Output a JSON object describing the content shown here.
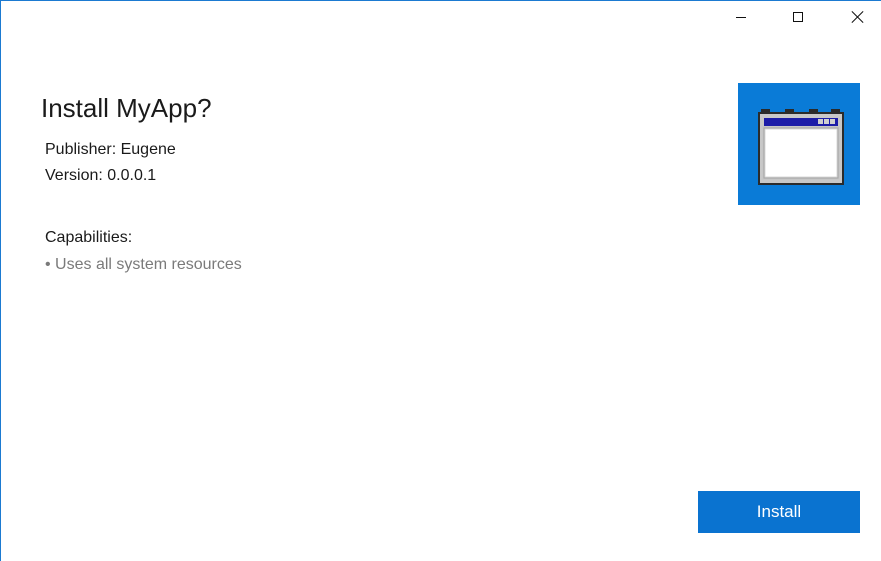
{
  "window": {
    "controls": {
      "minimize_icon": "minimize-icon",
      "maximize_icon": "maximize-icon",
      "close_icon": "close-icon"
    }
  },
  "header": {
    "title": "Install MyApp?"
  },
  "details": {
    "publisher": "Publisher: Eugene",
    "version": "Version: 0.0.0.1"
  },
  "capabilities": {
    "heading": "Capabilities:",
    "items": [
      "• Uses all system resources"
    ]
  },
  "logo": {
    "icon": "app-window-icon",
    "background_color": "#0a7bd7"
  },
  "actions": {
    "install_label": "Install",
    "accent_color": "#0a73d0"
  }
}
